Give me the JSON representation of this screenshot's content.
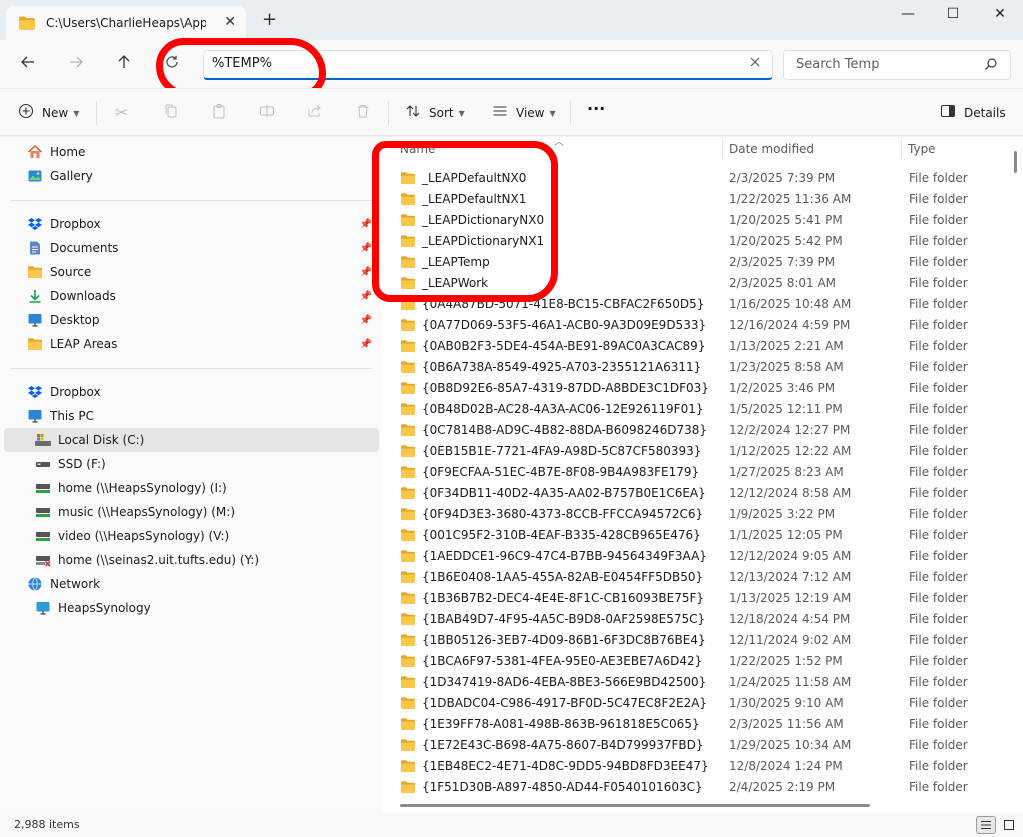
{
  "window": {
    "tab_title": "C:\\Users\\CharlieHeaps\\AppDa",
    "tab_close": "✕",
    "new_tab": "+",
    "minimize": "—",
    "maximize": "☐",
    "close": "✕"
  },
  "address": {
    "value": "%TEMP%",
    "search_placeholder": "Search Temp"
  },
  "toolbar": {
    "new_label": "New",
    "sort_label": "Sort",
    "view_label": "View",
    "more_label": "···",
    "details_label": "Details"
  },
  "sidebar": {
    "quick": [
      {
        "label": "Home",
        "icon": "home-icon"
      },
      {
        "label": "Gallery",
        "icon": "gallery-icon"
      }
    ],
    "pinned": [
      {
        "label": "Dropbox",
        "icon": "dropbox-icon"
      },
      {
        "label": "Documents",
        "icon": "documents-icon"
      },
      {
        "label": "Source",
        "icon": "folder-icon"
      },
      {
        "label": "Downloads",
        "icon": "download-icon"
      },
      {
        "label": "Desktop",
        "icon": "desktop-icon"
      },
      {
        "label": "LEAP Areas",
        "icon": "folder-icon"
      }
    ],
    "tree": [
      {
        "label": "Dropbox",
        "icon": "dropbox-icon",
        "indent": 0
      },
      {
        "label": "This PC",
        "icon": "pc-icon",
        "indent": 0
      },
      {
        "label": "Local Disk (C:)",
        "icon": "drive-icon",
        "indent": 1,
        "selected": true
      },
      {
        "label": "SSD (F:)",
        "icon": "drive-icon",
        "indent": 1
      },
      {
        "label": "home (\\\\HeapsSynology) (I:)",
        "icon": "network-drive-icon",
        "indent": 1
      },
      {
        "label": "music (\\\\HeapsSynology) (M:)",
        "icon": "network-drive-icon",
        "indent": 1
      },
      {
        "label": "video (\\\\HeapsSynology) (V:)",
        "icon": "network-drive-icon",
        "indent": 1
      },
      {
        "label": "home (\\\\seinas2.uit.tufts.edu) (Y:)",
        "icon": "disconnected-drive-icon",
        "indent": 1
      },
      {
        "label": "Network",
        "icon": "network-icon",
        "indent": 0
      },
      {
        "label": "HeapsSynology",
        "icon": "computer-icon",
        "indent": 1
      }
    ]
  },
  "columns": {
    "name": "Name",
    "date": "Date modified",
    "type": "Type"
  },
  "files": [
    {
      "name": "_LEAPDefaultNX0",
      "date": "2/3/2025 7:39 PM",
      "type": "File folder"
    },
    {
      "name": "_LEAPDefaultNX1",
      "date": "1/22/2025 11:36 AM",
      "type": "File folder"
    },
    {
      "name": "_LEAPDictionaryNX0",
      "date": "1/20/2025 5:41 PM",
      "type": "File folder"
    },
    {
      "name": "_LEAPDictionaryNX1",
      "date": "1/20/2025 5:42 PM",
      "type": "File folder"
    },
    {
      "name": "_LEAPTemp",
      "date": "2/3/2025 7:39 PM",
      "type": "File folder"
    },
    {
      "name": "_LEAPWork",
      "date": "2/3/2025 8:01 AM",
      "type": "File folder"
    },
    {
      "name": "{0A4A87BD-5071-41E8-BC15-CBFAC2F650D5}",
      "date": "1/16/2025 10:48 AM",
      "type": "File folder"
    },
    {
      "name": "{0A77D069-53F5-46A1-ACB0-9A3D09E9D533}",
      "date": "12/16/2024 4:59 PM",
      "type": "File folder"
    },
    {
      "name": "{0AB0B2F3-5DE4-454A-BE91-89AC0A3CAC89}",
      "date": "1/13/2025 2:21 AM",
      "type": "File folder"
    },
    {
      "name": "{0B6A738A-8549-4925-A703-2355121A6311}",
      "date": "1/23/2025 8:58 AM",
      "type": "File folder"
    },
    {
      "name": "{0B8D92E6-85A7-4319-87DD-A8BDE3C1DF03}",
      "date": "1/2/2025 3:46 PM",
      "type": "File folder"
    },
    {
      "name": "{0B48D02B-AC28-4A3A-AC06-12E926119F01}",
      "date": "1/5/2025 12:11 PM",
      "type": "File folder"
    },
    {
      "name": "{0C7814B8-AD9C-4B82-88DA-B6098246D738}",
      "date": "12/2/2024 12:27 PM",
      "type": "File folder"
    },
    {
      "name": "{0EB15B1E-7721-4FA9-A98D-5C87CF580393}",
      "date": "1/12/2025 12:22 AM",
      "type": "File folder"
    },
    {
      "name": "{0F9ECFAA-51EC-4B7E-8F08-9B4A983FE179}",
      "date": "1/27/2025 8:23 AM",
      "type": "File folder"
    },
    {
      "name": "{0F34DB11-40D2-4A35-AA02-B757B0E1C6EA}",
      "date": "12/12/2024 8:58 AM",
      "type": "File folder"
    },
    {
      "name": "{0F94D3E3-3680-4373-8CCB-FFCCA94572C6}",
      "date": "1/9/2025 3:22 PM",
      "type": "File folder"
    },
    {
      "name": "{001C95F2-310B-4EAF-B335-428CB965E476}",
      "date": "1/1/2025 12:05 PM",
      "type": "File folder"
    },
    {
      "name": "{1AEDDCE1-96C9-47C4-B7BB-94564349F3AA}",
      "date": "12/12/2024 9:05 AM",
      "type": "File folder"
    },
    {
      "name": "{1B6E0408-1AA5-455A-82AB-E0454FF5DB50}",
      "date": "12/13/2024 7:12 AM",
      "type": "File folder"
    },
    {
      "name": "{1B36B7B2-DEC4-4E4E-8F1C-CB16093BE75F}",
      "date": "1/13/2025 12:19 AM",
      "type": "File folder"
    },
    {
      "name": "{1BAB49D7-4F95-4A5C-B9D8-0AF2598E575C}",
      "date": "12/18/2024 4:54 PM",
      "type": "File folder"
    },
    {
      "name": "{1BB05126-3EB7-4D09-86B1-6F3DC8B76BE4}",
      "date": "12/11/2024 9:02 AM",
      "type": "File folder"
    },
    {
      "name": "{1BCA6F97-5381-4FEA-95E0-AE3EBE7A6D42}",
      "date": "1/22/2025 1:52 PM",
      "type": "File folder"
    },
    {
      "name": "{1D347419-8AD6-4EBA-8BE3-566E9BD42500}",
      "date": "1/24/2025 11:58 AM",
      "type": "File folder"
    },
    {
      "name": "{1DBADC04-C986-4917-BF0D-5C47EC8F2E2A}",
      "date": "1/30/2025 9:10 AM",
      "type": "File folder"
    },
    {
      "name": "{1E39FF78-A081-498B-863B-961818E5C065}",
      "date": "2/3/2025 11:56 AM",
      "type": "File folder"
    },
    {
      "name": "{1E72E43C-B698-4A75-8607-B4D799937FBD}",
      "date": "1/29/2025 10:34 AM",
      "type": "File folder"
    },
    {
      "name": "{1EB48EC2-4E71-4D8C-9DD5-94BD8FD3EE47}",
      "date": "12/8/2024 1:24 PM",
      "type": "File folder"
    },
    {
      "name": "{1F51D30B-A897-4850-AD44-F0540101603C}",
      "date": "2/4/2025 2:19 PM",
      "type": "File folder"
    }
  ],
  "status": {
    "item_count": "2,988 items"
  },
  "colors": {
    "accent": "#0067c0",
    "folder": "#f8c53a",
    "annotation": "#ff0000"
  }
}
